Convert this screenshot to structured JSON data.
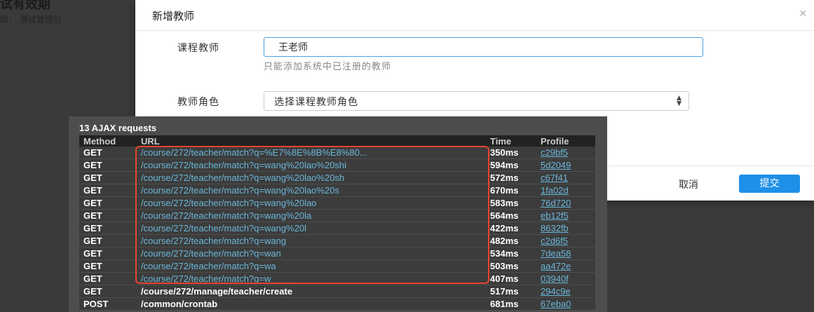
{
  "background": {
    "title": "试有效期",
    "subtitle": "助：  测试管理员"
  },
  "modal": {
    "title": "新增教师",
    "close_icon": "close-icon",
    "teacher_label": "课程教师",
    "teacher_value": "王老师",
    "teacher_help": "只能添加系统中已注册的教师",
    "role_label": "教师角色",
    "role_selected": "选择课程教师角色",
    "cancel": "取消",
    "submit": "提交",
    "accent_color": "#1e90e8"
  },
  "ajax": {
    "title": "13 AJAX requests",
    "headers": [
      "Method",
      "URL",
      "Time",
      "Profile"
    ],
    "rows": [
      {
        "method": "GET",
        "url": "/course/272/teacher/match?q=%E7%8E%8B%E8%80...",
        "time": "350ms",
        "profile": "c29bf5"
      },
      {
        "method": "GET",
        "url": "/course/272/teacher/match?q=wang%20lao%20shi",
        "time": "594ms",
        "profile": "5d2049"
      },
      {
        "method": "GET",
        "url": "/course/272/teacher/match?q=wang%20lao%20sh",
        "time": "572ms",
        "profile": "c67f41"
      },
      {
        "method": "GET",
        "url": "/course/272/teacher/match?q=wang%20lao%20s",
        "time": "670ms",
        "profile": "1fa02d"
      },
      {
        "method": "GET",
        "url": "/course/272/teacher/match?q=wang%20lao",
        "time": "583ms",
        "profile": "76d720"
      },
      {
        "method": "GET",
        "url": "/course/272/teacher/match?q=wang%20la",
        "time": "564ms",
        "profile": "eb12f5"
      },
      {
        "method": "GET",
        "url": "/course/272/teacher/match?q=wang%20l",
        "time": "422ms",
        "profile": "8632fb"
      },
      {
        "method": "GET",
        "url": "/course/272/teacher/match?q=wang",
        "time": "482ms",
        "profile": "c2d6f5"
      },
      {
        "method": "GET",
        "url": "/course/272/teacher/match?q=wan",
        "time": "534ms",
        "profile": "7dea58"
      },
      {
        "method": "GET",
        "url": "/course/272/teacher/match?q=wa",
        "time": "503ms",
        "profile": "aa472e"
      },
      {
        "method": "GET",
        "url": "/course/272/teacher/match?q=w",
        "time": "407ms",
        "profile": "03940f"
      },
      {
        "method": "GET",
        "url": "/course/272/manage/teacher/create",
        "time": "517ms",
        "profile": "294c9e"
      },
      {
        "method": "POST",
        "url": "/common/crontab",
        "time": "681ms",
        "profile": "67eba0"
      }
    ],
    "highlight_color": "#e8432e"
  }
}
